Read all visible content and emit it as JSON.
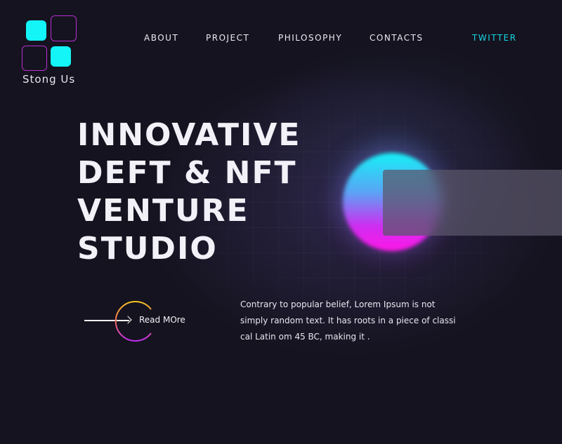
{
  "brand": {
    "name": "Stong Us",
    "colors": {
      "cyan": "#13f5f6",
      "magenta": "#b82fd2",
      "background": "#15131f"
    }
  },
  "nav": {
    "items": [
      "ABOUT",
      "PROJECT",
      "PHILOSOPHY",
      "CONTACTS"
    ],
    "social": "TWITTER"
  },
  "hero": {
    "lines": [
      "INNOVATIVE",
      "DEFT & NFT",
      "VENTURE",
      "STUDIO"
    ]
  },
  "cta": {
    "label": "Read MOre",
    "icon": "arrow-right-icon"
  },
  "description": {
    "lines": [
      "Contrary to popular belief, Lorem Ipsum is not",
      "simply random text. It has roots in a piece of classi",
      "cal Latin om 45 BC, making it ."
    ]
  }
}
